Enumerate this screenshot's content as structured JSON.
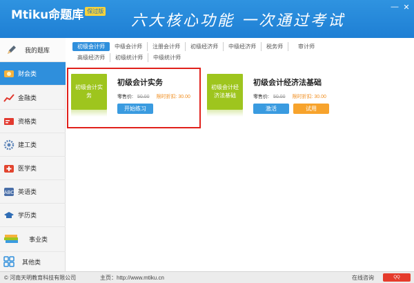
{
  "header": {
    "logo": "Mtiku命题库",
    "logo_tag": "保过版",
    "slogan": "六大核心功能 一次通过考试",
    "minimize": "—",
    "close": "✕"
  },
  "sidebar": {
    "my_library": "我的题库",
    "items": [
      {
        "label": "财会类",
        "icon": "coin-icon",
        "active": true
      },
      {
        "label": "金融类",
        "icon": "chart-icon",
        "active": false
      },
      {
        "label": "资格类",
        "icon": "certificate-icon",
        "active": false
      },
      {
        "label": "建工类",
        "icon": "gear-icon",
        "active": false
      },
      {
        "label": "医学类",
        "icon": "medical-kit-icon",
        "active": false
      },
      {
        "label": "英语类",
        "icon": "abc-icon",
        "active": false
      },
      {
        "label": "学历类",
        "icon": "graduation-cap-icon",
        "active": false
      },
      {
        "label": "事业类",
        "icon": "books-icon",
        "active": false
      },
      {
        "label": "其他类",
        "icon": "grid-icon",
        "active": false
      }
    ]
  },
  "tabs": {
    "row1": [
      "初级会计师",
      "中级会计师",
      "注册会计师",
      "初级经济师",
      "中级经济师",
      "税务师",
      "审计师"
    ],
    "row2": [
      "高级经济师",
      "初级统计师",
      "中级统计师"
    ],
    "active": "初级会计师"
  },
  "cards": [
    {
      "cover": "初级会计实务",
      "title": "初级会计实务",
      "price_label": "零售价:",
      "old_price": "50.00",
      "discount": "限时折扣: 30.00",
      "buttons": [
        "开始练习"
      ]
    },
    {
      "cover": "初级会计经济法基础",
      "title": "初级会计经济法基础",
      "price_label": "零售价:",
      "old_price": "50.00",
      "discount": "限时折扣: 30.00",
      "buttons": [
        "激活",
        "试用"
      ]
    }
  ],
  "statusbar": {
    "copyright": "© 河南天明教育科技有限公司",
    "homepage": "主页：http://www.mtiku.cn",
    "online": "在线咨询"
  },
  "colors": {
    "header_blue": "#1e7fd4",
    "active_blue": "#2f8fdc",
    "cover_green": "#9ec51e",
    "discount_orange": "#f08c1c",
    "highlight_red": "#e0201a"
  }
}
